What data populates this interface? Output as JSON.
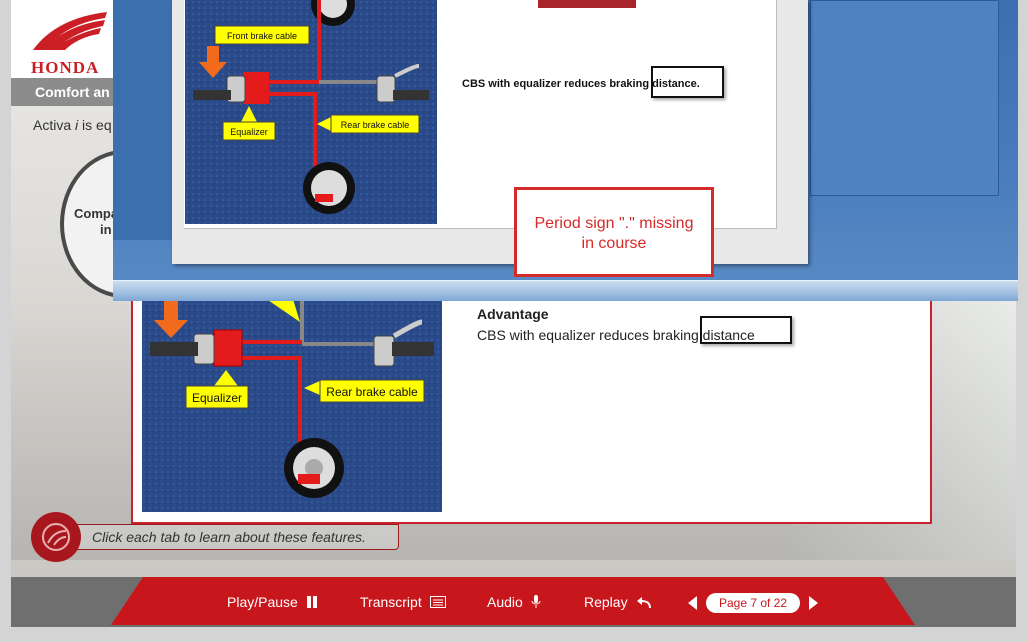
{
  "brand": {
    "logo_text": "HONDA",
    "accent": "#c8161d"
  },
  "section": {
    "title": "Comfort an"
  },
  "intro": {
    "before_italic": "Activa ",
    "italic": "i",
    "after_italic": " is eq"
  },
  "compare": {
    "line1": "Compa",
    "line2": "in"
  },
  "overlay": {
    "slide_text": "CBS with equalizer reduces braking distance.",
    "callout": {
      "line1": "Period sign \".\" missing",
      "line2": "in course",
      "color": "#d42a2a"
    },
    "image_labels": {
      "front": "Front brake cable",
      "equalizer": "Equalizer",
      "rear": "Rear brake cable"
    }
  },
  "detail": {
    "title": "Advantage",
    "text": "CBS with equalizer reduces braking distance",
    "image_labels": {
      "equalizer": "Equalizer",
      "rear": "Rear brake cable"
    }
  },
  "hint": {
    "text": "Click each tab to learn about these features."
  },
  "nav": {
    "play_pause": "Play/Pause",
    "transcript": "Transcript",
    "audio": "Audio",
    "replay": "Replay",
    "page_indicator": "Page 7 of 22"
  },
  "icons": [
    "pause-icon",
    "transcript-icon",
    "microphone-icon",
    "replay-icon",
    "prev-arrow-icon",
    "next-arrow-icon",
    "hint-gesture-icon"
  ]
}
